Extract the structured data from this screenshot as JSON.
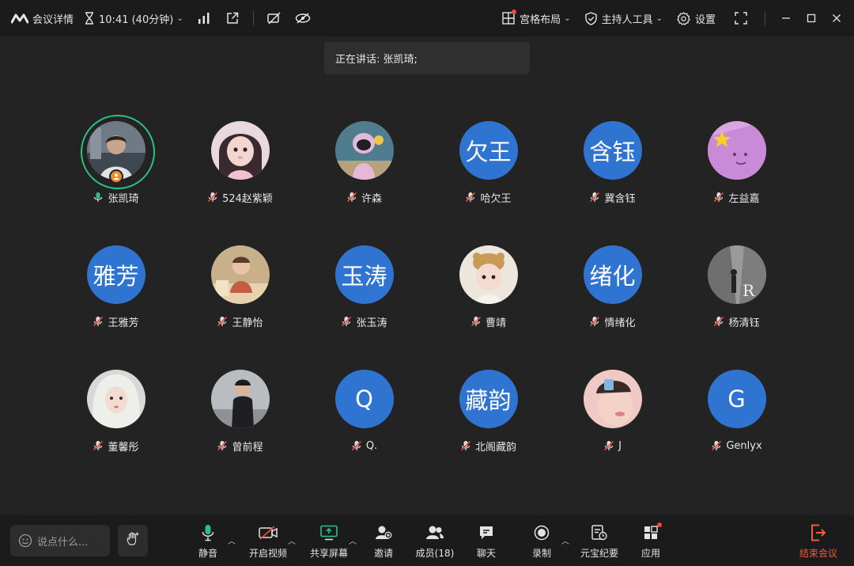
{
  "titlebar": {
    "meeting_details_label": "会议详情",
    "timer_text": "10:41 (40分钟)",
    "layout_label": "宫格布局",
    "host_tools_label": "主持人工具",
    "settings_label": "设置",
    "icons": [
      "logo-icon",
      "hourglass-icon",
      "signal-icon",
      "external-link-icon",
      "video-off-icon",
      "hide-icon",
      "grid-layout-icon",
      "shield-icon",
      "gear-icon",
      "fullscreen-icon",
      "minimize-icon",
      "maximize-icon",
      "close-icon"
    ]
  },
  "speaking": {
    "text": "正在讲话: 张凯琦;"
  },
  "participants": [
    {
      "name": "张凯琦",
      "avatar_type": "photo",
      "avatar_text": "",
      "speaking": true,
      "host": true
    },
    {
      "name": "524赵紫颖",
      "avatar_type": "photo",
      "avatar_text": ""
    },
    {
      "name": "许森",
      "avatar_type": "photo",
      "avatar_text": ""
    },
    {
      "name": "哈欠王",
      "avatar_type": "text",
      "avatar_text": "欠王"
    },
    {
      "name": "冀含钰",
      "avatar_type": "text",
      "avatar_text": "含钰"
    },
    {
      "name": "左益嘉",
      "avatar_type": "photo",
      "avatar_text": ""
    },
    {
      "name": "王雅芳",
      "avatar_type": "text",
      "avatar_text": "雅芳"
    },
    {
      "name": "王静怡",
      "avatar_type": "photo",
      "avatar_text": ""
    },
    {
      "name": "张玉涛",
      "avatar_type": "text",
      "avatar_text": "玉涛"
    },
    {
      "name": "曹靖",
      "avatar_type": "photo",
      "avatar_text": ""
    },
    {
      "name": "情绪化",
      "avatar_type": "text",
      "avatar_text": "绪化"
    },
    {
      "name": "杨清钰",
      "avatar_type": "photo",
      "avatar_text": ""
    },
    {
      "name": "董馨彤",
      "avatar_type": "photo",
      "avatar_text": ""
    },
    {
      "name": "曾前程",
      "avatar_type": "photo",
      "avatar_text": ""
    },
    {
      "name": "Q.",
      "avatar_type": "text",
      "avatar_text": "Q"
    },
    {
      "name": "北阁藏韵",
      "avatar_type": "text",
      "avatar_text": "藏韵"
    },
    {
      "name": "J",
      "avatar_type": "photo",
      "avatar_text": ""
    },
    {
      "name": "Genlyx",
      "avatar_type": "text",
      "avatar_text": "G"
    }
  ],
  "toolbar": {
    "chat_placeholder": "说点什么...",
    "mute_label": "静音",
    "video_label": "开启视频",
    "share_label": "共享屏幕",
    "invite_label": "邀请",
    "members_label": "成员(18)",
    "chat_label": "聊天",
    "record_label": "录制",
    "ai_minutes_label": "元宝纪要",
    "apps_label": "应用",
    "end_label": "结束会议"
  },
  "colors": {
    "background": "#232323",
    "bar": "#1b1b1b",
    "avatar_blue": "#2f74d0",
    "speaking_ring": "#2fbf86",
    "mic_green": "#2fbf86",
    "end_red": "#f05a3e",
    "badge_orange": "#f08a24"
  }
}
